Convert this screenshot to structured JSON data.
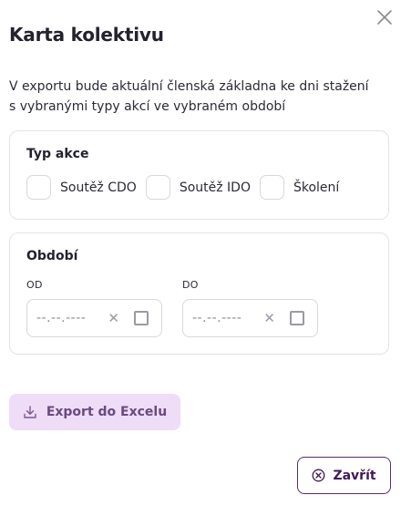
{
  "dialog": {
    "title": "Karta kolektivu",
    "description_line1": "V exportu bude aktuální členská základna ke dni stažení",
    "description_line2": "s vybranými typy akcí ve vybraném období"
  },
  "action_type": {
    "title": "Typ akce",
    "options": [
      {
        "label": "Soutěž CDO",
        "checked": false
      },
      {
        "label": "Soutěž IDO",
        "checked": false
      },
      {
        "label": "Školení",
        "checked": false
      }
    ]
  },
  "period": {
    "title": "Období",
    "from": {
      "label": "OD",
      "value": "--.--.----"
    },
    "to": {
      "label": "DO",
      "value": "--.--.----"
    }
  },
  "actions": {
    "export_label": "Export do Excelu",
    "close_label": "Zavřít"
  },
  "colors": {
    "accent": "#5b2a6f",
    "export_bg": "#efdcf7"
  }
}
